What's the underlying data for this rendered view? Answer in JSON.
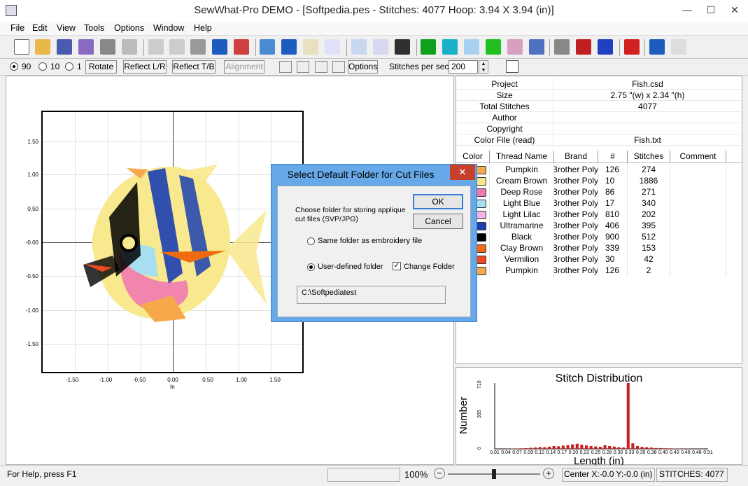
{
  "window": {
    "title": "SewWhat-Pro DEMO - [Softpedia.pes - Stitches: 4077  Hoop: 3.94 X 3.94 (in)]",
    "minimize": "—",
    "maximize": "☐",
    "close": "✕"
  },
  "menu": [
    "File",
    "Edit",
    "View",
    "Tools",
    "Options",
    "Window",
    "Help"
  ],
  "toolbar2": {
    "radio_90": "90",
    "radio_10": "10",
    "radio_1": "1",
    "rotate": "Rotate",
    "reflect_lr": "Reflect L/R",
    "reflect_tb": "Reflect T/B",
    "alignment": "Alignment",
    "options": "Options",
    "stitches_per_sec_label": "Stitches per sec",
    "stitches_per_sec_value": "200"
  },
  "plot": {
    "yticks": [
      "1.50",
      "1.00",
      "0.50",
      "-0.00",
      "-0.50",
      "-1.00",
      "-1.50"
    ],
    "xticks": [
      "-1.50",
      "-1.00",
      "-0.50",
      "0.00",
      "0.50",
      "1.00",
      "1.50"
    ],
    "xunit": "In"
  },
  "info": [
    {
      "key": "Project",
      "value": "Fish.csd"
    },
    {
      "key": "Size",
      "value": "2.75 \"(w) x 2.34 \"(h)"
    },
    {
      "key": "Total Stitches",
      "value": "4077"
    },
    {
      "key": "Author",
      "value": ""
    },
    {
      "key": "Copyright",
      "value": ""
    },
    {
      "key": "Color File (read)",
      "value": "Fish.txt"
    }
  ],
  "thread_headers": [
    "Color",
    "Thread Name",
    "Brand",
    "#",
    "Stitches",
    "Comment"
  ],
  "threads": [
    {
      "name": "Pumpkin",
      "brand": "Brother Poly",
      "num": "126",
      "stitches": "274",
      "color": "#f7a84a"
    },
    {
      "name": "Cream Brown",
      "brand": "Brother Poly",
      "num": "10",
      "stitches": "1886",
      "color": "#f8e98e"
    },
    {
      "name": "Deep Rose",
      "brand": "Brother Poly",
      "num": "86",
      "stitches": "271",
      "color": "#f07ab0"
    },
    {
      "name": "Light Blue",
      "brand": "Brother Poly",
      "num": "17",
      "stitches": "340",
      "color": "#a8dff0"
    },
    {
      "name": "Light Lilac",
      "brand": "Brother Poly",
      "num": "810",
      "stitches": "202",
      "color": "#f3b4e8"
    },
    {
      "name": "Ultramarine",
      "brand": "Brother Poly",
      "num": "406",
      "stitches": "395",
      "color": "#1b3fb0"
    },
    {
      "name": "Black",
      "brand": "Brother Poly",
      "num": "900",
      "stitches": "512",
      "color": "#000000"
    },
    {
      "name": "Clay Brown",
      "brand": "Brother Poly",
      "num": "339",
      "stitches": "153",
      "color": "#f06a10"
    },
    {
      "name": "Vermilion",
      "brand": "Brother Poly",
      "num": "30",
      "stitches": "42",
      "color": "#f04a20"
    },
    {
      "name": "Pumpkin",
      "brand": "Brother Poly",
      "num": "126",
      "stitches": "2",
      "color": "#f7a84a"
    }
  ],
  "distribution": {
    "title": "Stitch Distribution",
    "ylabel": "Number",
    "xlabel": "Length (in)",
    "yticks": [
      "710",
      "355",
      "0"
    ],
    "xticks": [
      "0.01",
      "0.04",
      "0.07",
      "0.09",
      "0.12",
      "0.14",
      "0.17",
      "0.20",
      "0.22",
      "0.25",
      "0.28",
      "0.30",
      "0.33",
      "0.35",
      "0.38",
      "0.40",
      "0.43",
      "0.46",
      "0.48",
      "0.51"
    ],
    "peak": 710,
    "bars": [
      0,
      0,
      2,
      4,
      3,
      6,
      8,
      12,
      15,
      20,
      18,
      24,
      30,
      28,
      35,
      40,
      48,
      55,
      45,
      38,
      30,
      26,
      22,
      40,
      30,
      25,
      18,
      15,
      710,
      60,
      30,
      22,
      18,
      14,
      10,
      8,
      6,
      5,
      4,
      3,
      2,
      2,
      1,
      1,
      1,
      0
    ]
  },
  "dialog": {
    "title": "Select Default Folder for Cut Files",
    "close": "✕",
    "text": "Choose folder for storing applique cut files (SVP/JPG)",
    "ok": "OK",
    "cancel": "Cancel",
    "radio_same": "Same folder as embroidery file",
    "radio_user": "User-defined folder",
    "check_change": "Change Folder",
    "check_mark": "✓",
    "path": "C:\\Softpediatest"
  },
  "status": {
    "help": "For Help, press F1",
    "zoom": "100%",
    "minus": "−",
    "plus": "+",
    "center": "Center X:-0.0 Y:-0.0 (in)",
    "stitches": "STITCHES:  4077"
  }
}
